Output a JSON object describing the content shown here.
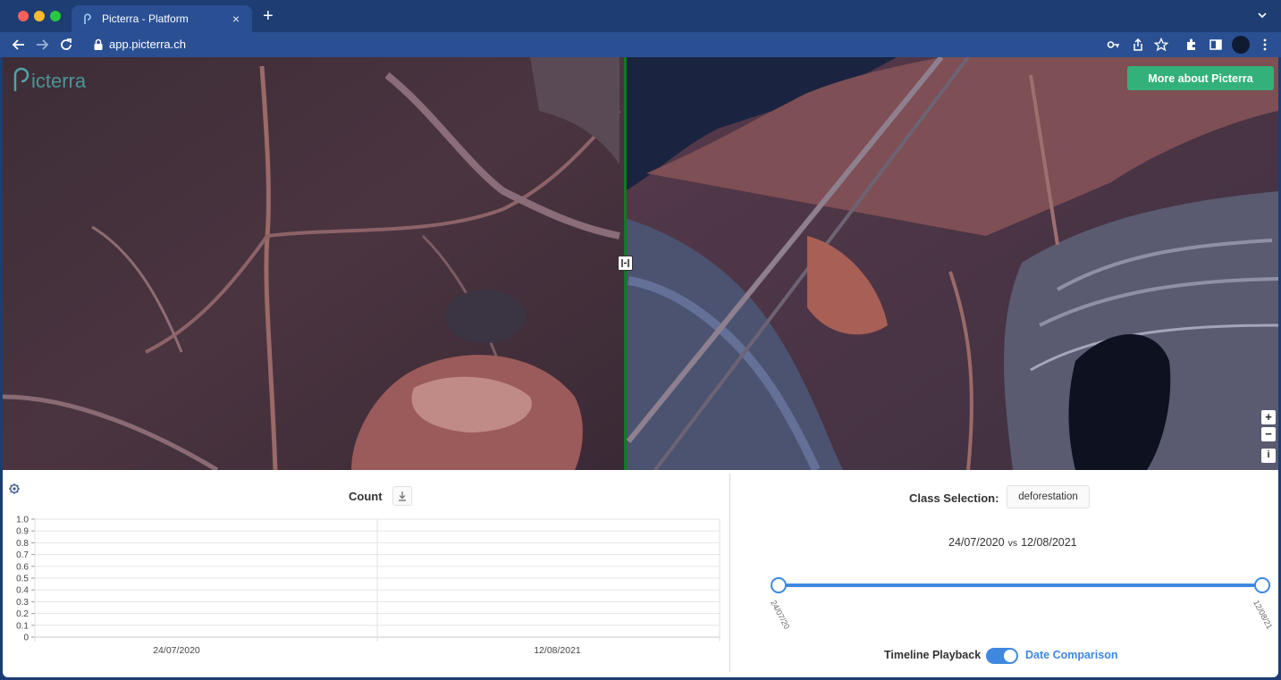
{
  "browser": {
    "tab_title": "Picterra - Platform",
    "tab_close": "×",
    "new_tab": "+",
    "url": "app.picterra.ch",
    "icons": [
      "back-icon",
      "forward-icon",
      "reload-icon",
      "lock-icon",
      "key-icon",
      "share-icon",
      "star-icon",
      "extensions-icon",
      "sidebar-icon",
      "profile-avatar",
      "kebab-menu-icon"
    ]
  },
  "map": {
    "more_button": "More about Picterra",
    "zoom_in": "+",
    "zoom_out": "−",
    "info": "i",
    "split_line_color": "#0b7d1f",
    "accent_button_color": "#33b17a"
  },
  "count_panel": {
    "title": "Count",
    "download_icon": "download-icon",
    "settings_icon": "gear-icon"
  },
  "chart_data": {
    "type": "line",
    "title": "Count",
    "categories": [
      "24/07/2020",
      "12/08/2021"
    ],
    "series": [],
    "ylim": [
      0,
      1.0
    ],
    "yticks": [
      "1.0",
      "0.9",
      "0.8",
      "0.7",
      "0.6",
      "0.5",
      "0.4",
      "0.3",
      "0.2",
      "0.1",
      "0"
    ],
    "grid": true
  },
  "comparison_panel": {
    "class_label": "Class Selection:",
    "class_value": "deforestation",
    "date_a": "24/07/2020",
    "vs": "vs",
    "date_b": "12/08/2021",
    "slider_tick_start": "24/07/20",
    "slider_tick_end": "12/08/21",
    "playback_label": "Timeline Playback",
    "comparison_label": "Date Comparison",
    "toggle_on": true,
    "accent_color": "#3e88e0"
  }
}
